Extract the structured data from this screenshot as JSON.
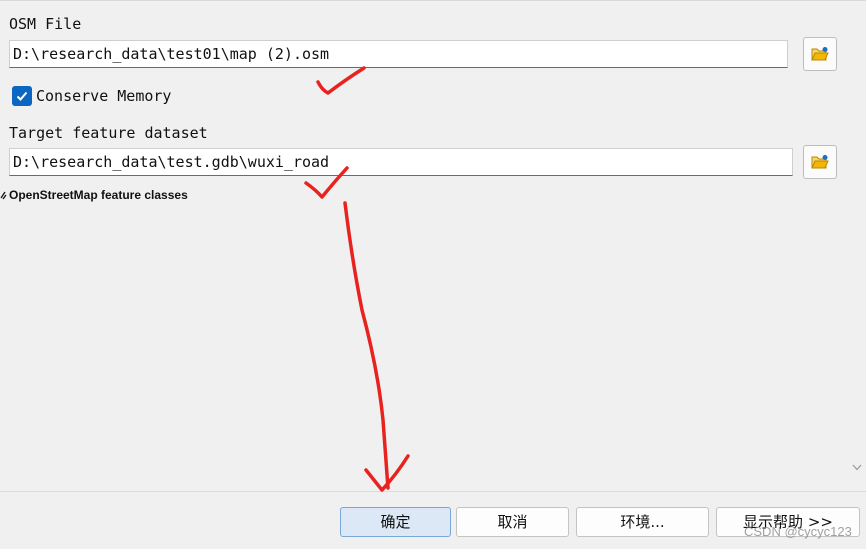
{
  "fields": {
    "osm_file": {
      "label": "OSM File",
      "value": "D:\\research_data\\test01\\map (2).osm"
    },
    "conserve_memory": {
      "label": "Conserve Memory",
      "checked": true
    },
    "target_dataset": {
      "label": "Target feature dataset",
      "value": "D:\\research_data\\test.gdb\\wuxi_road"
    }
  },
  "section": {
    "title": "OpenStreetMap feature classes"
  },
  "footer": {
    "ok_label": "确定",
    "cancel_label": "取消",
    "env_label": "环境...",
    "help_label": "显示帮助 >>"
  },
  "watermark": "CSDN @cycyc123",
  "colors": {
    "accent": "#0b66c2",
    "annotation": "#e8231f",
    "folder": "#f2b705"
  },
  "icons": {
    "browse": "open-folder-icon",
    "check": "checkmark-icon",
    "collapse": "collapse-chevron-icon",
    "scroll": "scroll-down-arrow-icon"
  }
}
